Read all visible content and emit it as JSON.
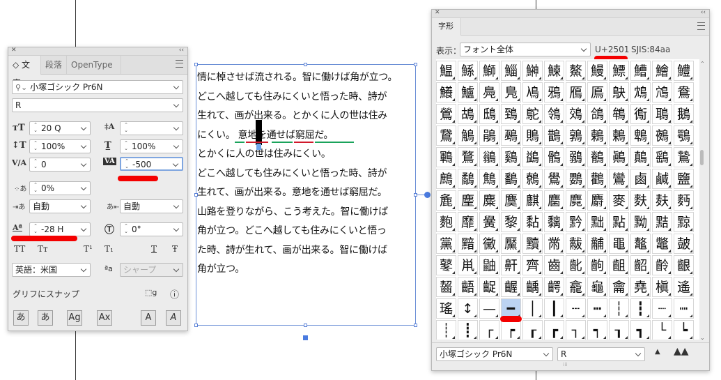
{
  "char_panel": {
    "tabs": [
      "◇ 文字",
      "段落",
      "OpenType"
    ],
    "font_family": "小塚ゴシック Pr6N",
    "font_style": "R",
    "font_size": "20 Q",
    "leading": "",
    "vertical_scale": "100%",
    "horizontal_scale": "100%",
    "kerning": "0",
    "tracking": "-500",
    "tsume": "0%",
    "mojikumi_before": "自動",
    "mojikumi_after": "自動",
    "baseline_shift": "-28 H",
    "rotation": "0°",
    "style_buttons": [
      "TT",
      "Tт",
      "T¹",
      "T₁",
      "T",
      "Ŧ"
    ],
    "language": "英語：米国",
    "aa_label": "ªa",
    "antialias": "シャープ",
    "snap_label": "グリフにスナップ",
    "bottom_buttons": [
      "あ",
      "あ",
      "Ag",
      "Ax",
      "A",
      "A"
    ]
  },
  "text_frame": {
    "lines": [
      "情に棹させば流される。智に働けば角が立つ。",
      "どこへ越しても住みにくいと悟った時、詩が",
      "生れて、画が出来る。とかくに人の世は住み",
      "にくい。 意地を通せば窮屈だ。",
      "とかくに人の世は住みにくい。",
      "どこへ越しても住みにくいと悟った時、詩が",
      "生れて、画が出来る。意地を通せば窮屈だ。",
      "山路を登りながら、こう考えた。智に働けば",
      "角が立つ。どこへ越しても住みにくいと悟っ",
      "た時、詩が生れて、画が出来る。智に働けば",
      "角が立つ。"
    ]
  },
  "glyph_panel": {
    "title": "字形",
    "show_label": "表示：",
    "show_value": "フォント全体",
    "unicode": "U+2501",
    "sjis": "SJIS:84aa",
    "font_family": "小塚ゴシック Pr6N",
    "font_style": "R",
    "rows": [
      [
        "鰛",
        "鯀",
        "鰤",
        "鯔",
        "鰰",
        "鰊",
        "鰲",
        "鰻",
        "鰾",
        "鰽",
        "鱠",
        "鱧"
      ],
      [
        "鱶",
        "鱸",
        "鳧",
        "鳬",
        "鳰",
        "鴉",
        "鴈",
        "鳫",
        "鴃",
        "鴆",
        "鴪",
        "鴦"
      ],
      [
        "鶯",
        "鴣",
        "鴟",
        "鵄",
        "鴕",
        "鴒",
        "鵁",
        "鴿",
        "鴾",
        "鵆",
        "鵈",
        "鵝"
      ],
      [
        "鵞",
        "鵤",
        "鵑",
        "鵐",
        "鵙",
        "鵲",
        "鶉",
        "鶇",
        "鶫",
        "鵯",
        "鵺",
        "鶚"
      ],
      [
        "鶤",
        "鶩",
        "鶲",
        "鷄",
        "鷁",
        "鶻",
        "鶸",
        "鶺",
        "鷆",
        "鷏",
        "鷂",
        "鷙"
      ],
      [
        "鷓",
        "鷸",
        "鷦",
        "鷭",
        "鷯",
        "鷽",
        "鸚",
        "鸛",
        "鸞",
        "鹵",
        "鹹",
        "鹽"
      ],
      [
        "麁",
        "麈",
        "麋",
        "麌",
        "麒",
        "麕",
        "麑",
        "麝",
        "麥",
        "麩",
        "麸",
        "麪"
      ],
      [
        "麭",
        "靡",
        "黌",
        "黎",
        "黏",
        "黐",
        "黔",
        "黜",
        "點",
        "黝",
        "黠",
        "黥"
      ],
      [
        "黨",
        "黯",
        "黴",
        "黶",
        "黷",
        "黹",
        "黻",
        "黼",
        "黽",
        "鼇",
        "鼈",
        "皷"
      ],
      [
        "鼕",
        "鼡",
        "鼬",
        "鼾",
        "齊",
        "齒",
        "齔",
        "齣",
        "齟",
        "齠",
        "齡",
        "齦"
      ],
      [
        "齧",
        "齬",
        "齪",
        "齷",
        "齲",
        "齶",
        "龕",
        "龜",
        "龠",
        "堯",
        "槇",
        "遙"
      ],
      [
        "瑤",
        "↕",
        "—",
        "━",
        "│",
        "┃",
        "┄",
        "┅",
        "┆",
        "┇",
        "┈",
        "┉"
      ],
      [
        "┊",
        "┋",
        "┌",
        "┍",
        "┎",
        "┏",
        "┐",
        "┑",
        "┒",
        "┓",
        "└",
        "┕"
      ]
    ],
    "selected": "━"
  }
}
